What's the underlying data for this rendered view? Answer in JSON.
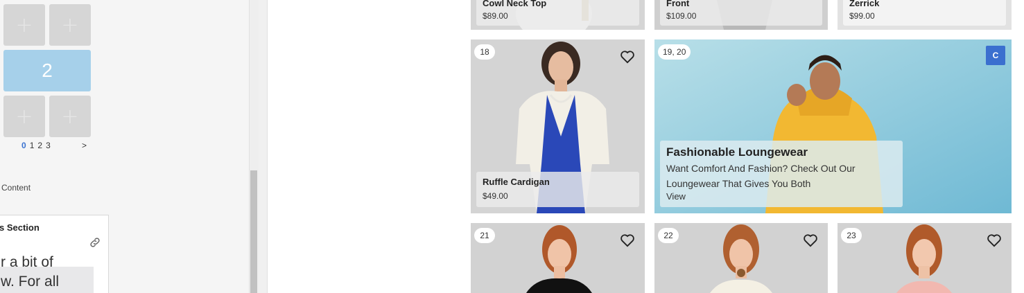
{
  "builder": {
    "tile_plus": "+",
    "active_tile": "2",
    "pager": {
      "pages": [
        "0",
        "1",
        "2",
        "3"
      ],
      "active_page": "0",
      "next": ">"
    },
    "section_label": "Content",
    "card": {
      "title": "s Section",
      "preview_line_1": "r a bit of",
      "preview_line_2": "w. For all"
    }
  },
  "products_top": [
    {
      "name": "Cowl Neck Top",
      "price": "$89.00"
    },
    {
      "name": "Front",
      "price": "$109.00"
    },
    {
      "name": "Zerrick",
      "price": "$99.00"
    }
  ],
  "product_18": {
    "number": "18",
    "name": "Ruffle Cardigan",
    "price": "$49.00"
  },
  "promo": {
    "number": "19, 20",
    "badge": "C",
    "title": "Fashionable Loungewear",
    "desc_line1": "Want Comfort And Fashion? Check Out Our",
    "desc_line2": "Loungewear That Gives You Both",
    "cta": "View"
  },
  "products_bottom": [
    {
      "number": "21"
    },
    {
      "number": "22"
    },
    {
      "number": "23"
    }
  ],
  "icons": {
    "favorite": "heart-outline-icon",
    "link": "link-icon",
    "add": "plus-icon"
  },
  "colors": {
    "accent_blue": "#3b6fcf",
    "active_tile": "#a6d0ea",
    "promo_bg": "#87c8de"
  }
}
